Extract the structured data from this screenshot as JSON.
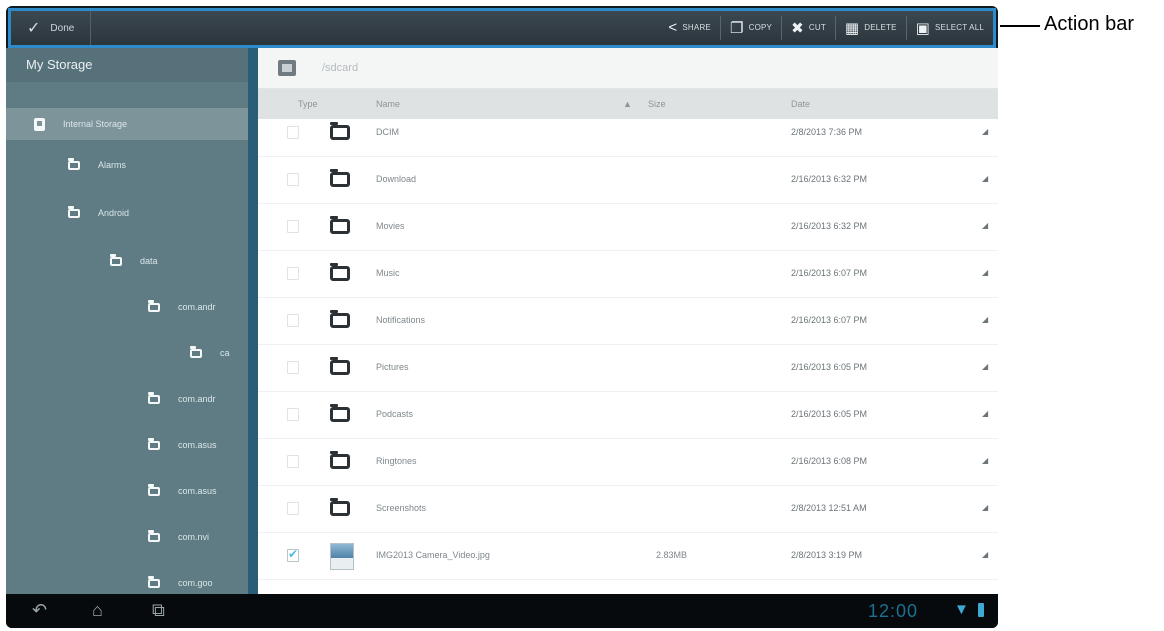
{
  "action_bar": {
    "done_label": "Done",
    "actions": [
      {
        "label": "SHARE",
        "icon": "share-icon"
      },
      {
        "label": "COPY",
        "icon": "copy-icon"
      },
      {
        "label": "CUT",
        "icon": "cut-icon"
      },
      {
        "label": "DELETE",
        "icon": "delete-icon"
      },
      {
        "label": "SELECT ALL",
        "icon": "select-all-icon"
      }
    ]
  },
  "sidebar": {
    "title": "My Storage",
    "items": [
      {
        "label": "Internal Storage",
        "type": "storage",
        "selected": true
      },
      {
        "label": "Alarms",
        "type": "folder"
      },
      {
        "label": "Android",
        "type": "folder"
      },
      {
        "label": "data",
        "type": "folder"
      },
      {
        "label": "com.andr",
        "type": "folder"
      },
      {
        "label": "ca",
        "type": "folder"
      },
      {
        "label": "com.andr",
        "type": "folder"
      },
      {
        "label": "com.asus",
        "type": "folder"
      },
      {
        "label": "com.asus",
        "type": "folder"
      },
      {
        "label": "com.nvi",
        "type": "folder"
      },
      {
        "label": "com.goo",
        "type": "folder"
      }
    ]
  },
  "content": {
    "path": "/sdcard",
    "columns": {
      "type": "Type",
      "name": "Name",
      "size": "Size",
      "date": "Date",
      "sort_indicator": "▲"
    },
    "rows": [
      {
        "name": "DCIM",
        "size": "",
        "date": "2/8/2013 7:36 PM",
        "type": "folder",
        "checked": false
      },
      {
        "name": "Download",
        "size": "",
        "date": "2/16/2013 6:32 PM",
        "type": "folder",
        "checked": false
      },
      {
        "name": "Movies",
        "size": "",
        "date": "2/16/2013 6:32 PM",
        "type": "folder",
        "checked": false
      },
      {
        "name": "Music",
        "size": "",
        "date": "2/16/2013 6:07 PM",
        "type": "folder",
        "checked": false
      },
      {
        "name": "Notifications",
        "size": "",
        "date": "2/16/2013 6:07 PM",
        "type": "folder",
        "checked": false
      },
      {
        "name": "Pictures",
        "size": "",
        "date": "2/16/2013 6:05 PM",
        "type": "folder",
        "checked": false
      },
      {
        "name": "Podcasts",
        "size": "",
        "date": "2/16/2013 6:05 PM",
        "type": "folder",
        "checked": false
      },
      {
        "name": "Ringtones",
        "size": "",
        "date": "2/16/2013 6:08 PM",
        "type": "folder",
        "checked": false
      },
      {
        "name": "Screenshots",
        "size": "",
        "date": "2/8/2013 12:51 AM",
        "type": "folder",
        "checked": false
      },
      {
        "name": "IMG2013 Camera_Video.jpg",
        "size": "2.83MB",
        "date": "2/8/2013 3:19 PM",
        "type": "image",
        "checked": true
      }
    ]
  },
  "navbar": {
    "clock": "12:00"
  },
  "annotation": {
    "label": "Action bar"
  }
}
